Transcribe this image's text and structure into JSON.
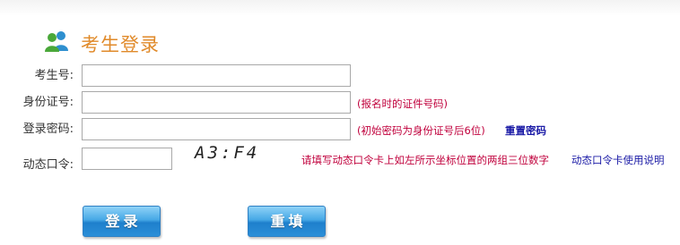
{
  "header": {
    "title": "考生登录",
    "icon": "users-icon"
  },
  "form": {
    "exam_no": {
      "label": "考生号:",
      "value": ""
    },
    "id_no": {
      "label": "身份证号:",
      "value": "",
      "hint": "(报名时的证件号码)"
    },
    "password": {
      "label": "登录密码:",
      "value": "",
      "hint": "(初始密码为身份证号后6位)",
      "reset_link": "重置密码"
    },
    "dynamic_code": {
      "label": "动态口令:",
      "value": "",
      "coordinates": "A3:F4",
      "hint": "请填写动态口令卡上如左所示坐标位置的两组三位数字",
      "help_link": "动态口令卡使用说明"
    }
  },
  "buttons": {
    "login": "登录",
    "reset": "重填"
  },
  "colors": {
    "title": "#e08a2a",
    "hint": "#c0003c",
    "link": "#1a1aa6",
    "button": "#2b8fd8"
  }
}
